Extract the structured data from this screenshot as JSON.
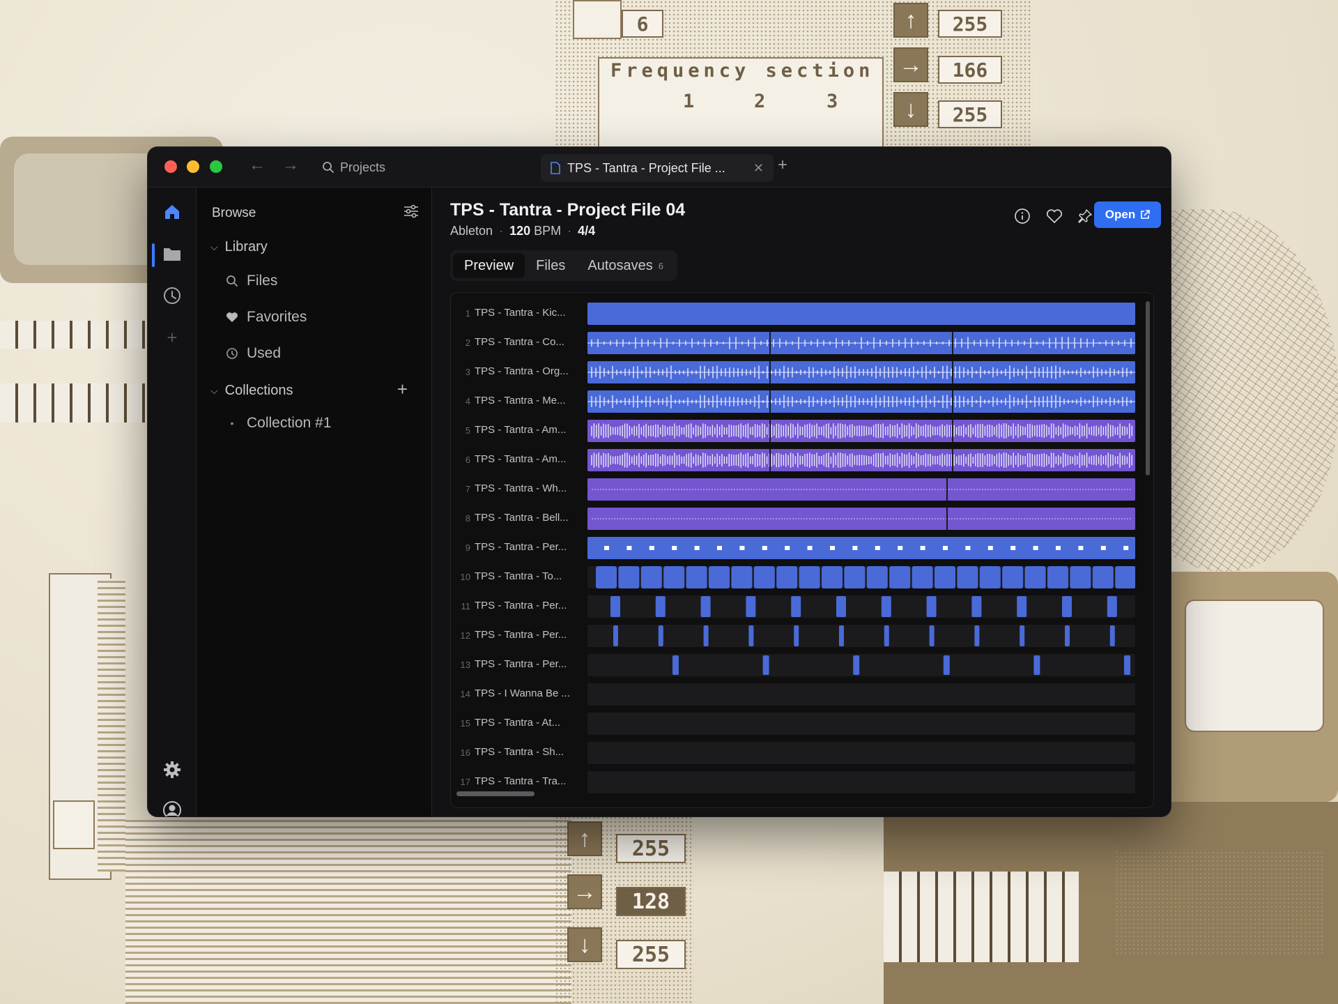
{
  "colors": {
    "accent": "#2f6ef1",
    "clip_blue": "#4a6ad8",
    "clip_purple": "#7356d0",
    "window_bg": "#121214"
  },
  "background": {
    "envelope_count": "6",
    "frequency_label": "Frequency section",
    "section_numbers": [
      "1",
      "2",
      "3"
    ],
    "top_values": [
      "255",
      "166",
      "255"
    ],
    "bottom_values": [
      "255",
      "128",
      "255"
    ]
  },
  "titlebar": {
    "search_label": "Projects",
    "tab_title": "TPS - Tantra - Project File ..."
  },
  "rail": {
    "items": [
      "home-icon",
      "folder-icon",
      "clock-icon",
      "plus-icon"
    ],
    "bottom": [
      "gear-icon",
      "account-icon"
    ]
  },
  "sidebar": {
    "title": "Browse",
    "library": {
      "label": "Library",
      "items": [
        {
          "label": "Files",
          "icon": "search-icon"
        },
        {
          "label": "Favorites",
          "icon": "heart-icon"
        },
        {
          "label": "Used",
          "icon": "clock-icon"
        }
      ]
    },
    "collections": {
      "label": "Collections",
      "items": [
        {
          "label": "Collection #1"
        }
      ]
    }
  },
  "project": {
    "title": "TPS - Tantra - Project File 04",
    "daw": "Ableton",
    "bpm": "120",
    "bpm_unit": "BPM",
    "time_signature": "4/4",
    "open_label": "Open"
  },
  "tabs": [
    {
      "label": "Preview",
      "active": true
    },
    {
      "label": "Files",
      "active": false
    },
    {
      "label": "Autosaves",
      "count": "6",
      "active": false
    }
  ],
  "tracks": [
    {
      "num": "1",
      "name": "TPS - Tantra - Kic...",
      "pattern": "solid",
      "color": "blue"
    },
    {
      "num": "2",
      "name": "TPS - Tantra - Co...",
      "pattern": "wave-sparse",
      "color": "blue"
    },
    {
      "num": "3",
      "name": "TPS - Tantra - Org...",
      "pattern": "wave-medium",
      "color": "blue"
    },
    {
      "num": "4",
      "name": "TPS - Tantra - Me...",
      "pattern": "wave-medium",
      "color": "blue"
    },
    {
      "num": "5",
      "name": "TPS - Tantra - Am...",
      "pattern": "wave-dense",
      "color": "purple"
    },
    {
      "num": "6",
      "name": "TPS - Tantra - Am...",
      "pattern": "wave-dense",
      "color": "purple"
    },
    {
      "num": "7",
      "name": "TPS - Tantra - Wh...",
      "pattern": "thin-line",
      "color": "purple"
    },
    {
      "num": "8",
      "name": "TPS - Tantra - Bell...",
      "pattern": "thin-line",
      "color": "purple"
    },
    {
      "num": "9",
      "name": "TPS - Tantra - Per...",
      "pattern": "dots",
      "color": "blue"
    },
    {
      "num": "10",
      "name": "TPS - Tantra - To...",
      "pattern": "blocks",
      "color": "blue"
    },
    {
      "num": "11",
      "name": "TPS - Tantra - Per...",
      "pattern": "hits-wide",
      "color": "blue"
    },
    {
      "num": "12",
      "name": "TPS - Tantra - Per...",
      "pattern": "hits-thin",
      "color": "blue"
    },
    {
      "num": "13",
      "name": "TPS - Tantra - Per...",
      "pattern": "hits-sparse",
      "color": "blue"
    },
    {
      "num": "14",
      "name": "TPS - I Wanna Be ...",
      "pattern": "empty",
      "color": "none"
    },
    {
      "num": "15",
      "name": "TPS - Tantra - At...",
      "pattern": "empty",
      "color": "none"
    },
    {
      "num": "16",
      "name": "TPS - Tantra - Sh...",
      "pattern": "empty",
      "color": "none"
    },
    {
      "num": "17",
      "name": "TPS - Tantra - Tra...",
      "pattern": "empty",
      "color": "none"
    }
  ]
}
